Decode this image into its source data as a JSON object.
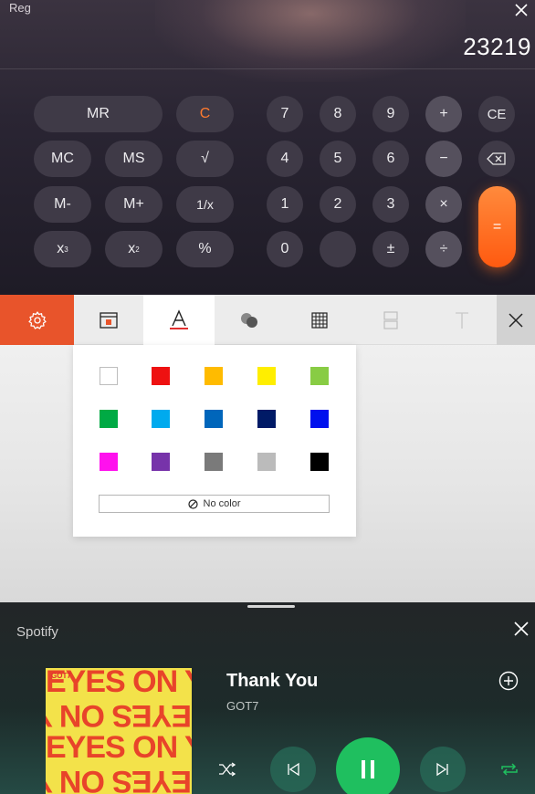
{
  "calculator": {
    "title": "Reg",
    "display": "23219",
    "keys": {
      "mr": "MR",
      "c": "C",
      "mc": "MC",
      "ms": "MS",
      "sqrt": "√",
      "mminus": "M-",
      "mplus": "M+",
      "inv": "1/x",
      "x3": "x",
      "x3_exp": "3",
      "x2": "x",
      "x2_exp": "2",
      "pct": "%",
      "n7": "7",
      "n8": "8",
      "n9": "9",
      "plus": "+",
      "ce": "CE",
      "n4": "4",
      "n5": "5",
      "n6": "6",
      "minus": "−",
      "n1": "1",
      "n2": "2",
      "n3": "3",
      "times": "×",
      "n0": "0",
      "blank": "",
      "plusminus": "±",
      "divide": "÷",
      "equals": "="
    },
    "colors": {
      "accent": "#ff6a1e",
      "key": "#3f3a47",
      "key_op": "#55505d"
    }
  },
  "style_panel": {
    "toolbar_icons": [
      "gear-icon",
      "fill-layout-icon",
      "font-color-icon",
      "shape-fill-icon",
      "table-grid-icon",
      "split-layout-icon",
      "text-icon",
      "close-icon"
    ],
    "swatches": [
      [
        "#ffffff",
        "#ee1111",
        "#ffbb00",
        "#ffee00",
        "#88cc44"
      ],
      [
        "#00aa44",
        "#00aaee",
        "#0066bb",
        "#001a66",
        "#0011ee"
      ],
      [
        "#ff11ee",
        "#7733aa",
        "#7a7a7a",
        "#bbbbbb",
        "#000000"
      ]
    ],
    "no_color_label": "No color",
    "accent": "#e8542b"
  },
  "spotify": {
    "title": "Spotify",
    "song": "Thank You",
    "artist": "GOT7",
    "album_art": {
      "lines": [
        "EYES ON YOU",
        "YOU NO SEYE",
        "EYES ON YOU",
        "YOU NO SEYE"
      ],
      "badge": "GOT7"
    },
    "controls": [
      "shuffle-icon",
      "previous-icon",
      "pause-icon",
      "next-icon",
      "repeat-icon"
    ],
    "accent": "#1fbf5f"
  }
}
